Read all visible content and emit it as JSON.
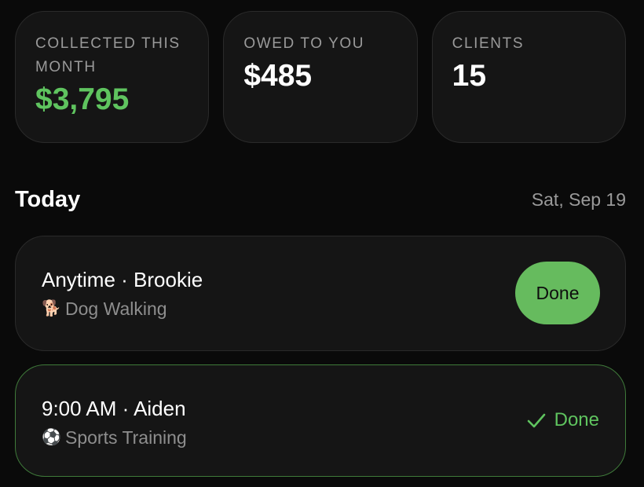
{
  "stats": [
    {
      "label": "COLLECTED THIS MONTH",
      "value": "$3,795",
      "value_color": "#5fc45f"
    },
    {
      "label": "OWED TO YOU",
      "value": "$485"
    },
    {
      "label": "CLIENTS",
      "value": "15"
    }
  ],
  "today": {
    "title": "Today",
    "date": "Sat, Sep 19"
  },
  "appointments": [
    {
      "title": "Anytime · Brookie",
      "service_icon": "dog-icon",
      "service": "Dog Walking",
      "action_label": "Done",
      "completed": false
    },
    {
      "title": "9:00 AM · Aiden",
      "service_icon": "soccer-ball-icon",
      "service": "Sports Training",
      "status_label": "Done",
      "completed": true
    }
  ],
  "colors": {
    "accent_green": "#66bb5e",
    "background": "#0a0a0a",
    "card": "#151515"
  }
}
